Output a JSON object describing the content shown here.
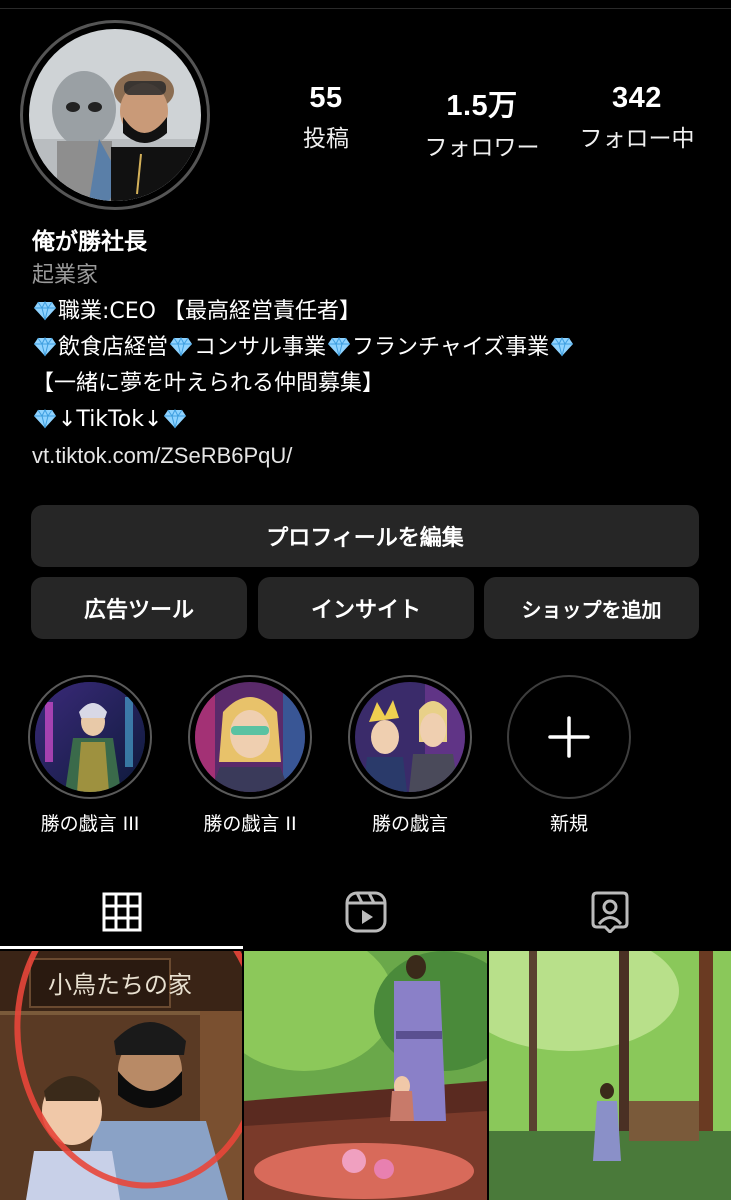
{
  "profile": {
    "name": "俺が勝社長",
    "category": "起業家",
    "bio_lines": [
      "職業:CEO 【最高経営責任者】",
      "飲食店経営",
      "コンサル事業",
      "フランチャイズ事業",
      "【一緒に夢を叶えられる仲間募集】",
      "↓TikTok↓"
    ],
    "link": "vt.tiktok.com/ZSeRB6PqU/"
  },
  "stats": {
    "posts": {
      "value": "55",
      "label": "投稿"
    },
    "followers": {
      "value": "1.5万",
      "label": "フォロワー"
    },
    "following": {
      "value": "342",
      "label": "フォロー中"
    }
  },
  "buttons": {
    "edit_profile": "プロフィールを編集",
    "ad_tools": "広告ツール",
    "insights": "インサイト",
    "add_shop": "ショップを追加"
  },
  "highlights": [
    {
      "label": "勝の戯言 III"
    },
    {
      "label": "勝の戯言 II"
    },
    {
      "label": "勝の戯言"
    },
    {
      "label": "新規"
    }
  ],
  "tabs": {
    "active": "grid",
    "items": [
      "grid-icon",
      "reels-icon",
      "tagged-icon"
    ]
  },
  "colors": {
    "background": "#000000",
    "button_bg": "#262626",
    "secondary_text": "#9a9a9a",
    "annotation_circle": "#e8463a",
    "gem": "#8fd3ff"
  }
}
